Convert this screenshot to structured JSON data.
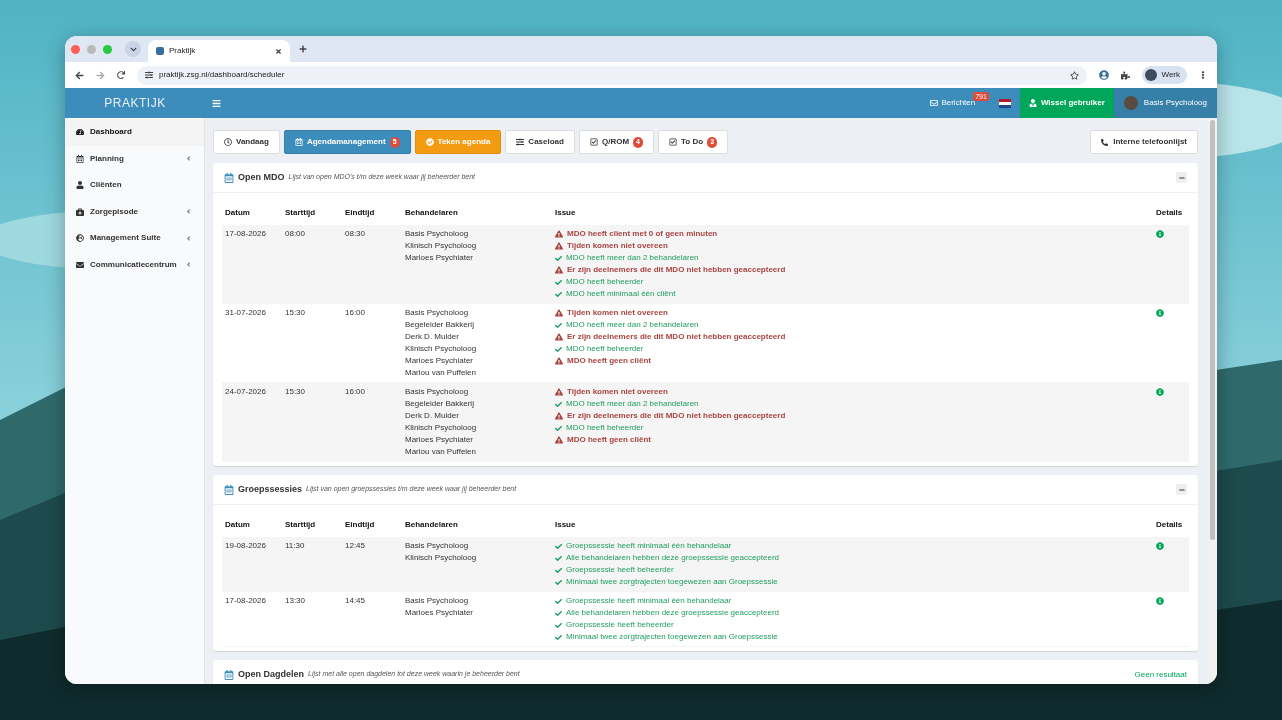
{
  "browser": {
    "tab_title": "Praktijk",
    "url": "praktijk.zsg.nl/dashboard/scheduler",
    "profile": "Werk"
  },
  "navbar": {
    "brand": "PRAKTIJK",
    "messages": {
      "label": "Berichten",
      "count": "791"
    },
    "switch_user": "Wissel gebruiker",
    "user": "Basis Psycholoog"
  },
  "sidebar": {
    "items": [
      {
        "label": "Dashboard",
        "selected": true,
        "submenu": false
      },
      {
        "label": "Planning",
        "selected": false,
        "submenu": true
      },
      {
        "label": "Cliënten",
        "selected": false,
        "submenu": false
      },
      {
        "label": "Zorgepisode",
        "selected": false,
        "submenu": true
      },
      {
        "label": "Management Suite",
        "selected": false,
        "submenu": true
      },
      {
        "label": "Communicatiecentrum",
        "selected": false,
        "submenu": true
      }
    ]
  },
  "toolbar": {
    "buttons": [
      {
        "label": "Vandaag",
        "kind": "default"
      },
      {
        "label": "Agendamanagement",
        "kind": "primary",
        "badge": "5"
      },
      {
        "label": "Teken agenda",
        "kind": "warning"
      },
      {
        "label": "Caseload",
        "kind": "default"
      },
      {
        "label": "Q/ROM",
        "kind": "default",
        "badge": "4"
      },
      {
        "label": "To Do",
        "kind": "default",
        "badge": "3"
      }
    ],
    "phone_list": "Interne telefoonlijst"
  },
  "panels": [
    {
      "title": "Open MDO",
      "subtitle": "Lijst van open MDO's t/m deze week waar jij beheerder bent",
      "columns": [
        "Datum",
        "Starttijd",
        "Eindtijd",
        "Behandelaren",
        "Issue",
        "Details"
      ],
      "rows": [
        {
          "datum": "17-08-2026",
          "start": "08:00",
          "end": "08:30",
          "behandelaren": [
            "Basis Psycholoog",
            "Klinisch Psycholoog",
            "Marloes Psychiater"
          ],
          "issues": [
            {
              "kind": "error",
              "text": "MDO heeft client met 0 of geen minuten"
            },
            {
              "kind": "error",
              "text": "Tijden komen niet overeen"
            },
            {
              "kind": "ok",
              "text": "MDO heeft meer dan 2 behandelaren"
            },
            {
              "kind": "error",
              "text": "Er zijn deelnemers die dit MDO niet hebben geaccepteerd"
            },
            {
              "kind": "ok",
              "text": "MDO heeft beheerder"
            },
            {
              "kind": "ok",
              "text": "MDO heeft minimaal één cliënt"
            }
          ]
        },
        {
          "datum": "31-07-2026",
          "start": "15:30",
          "end": "16:00",
          "behandelaren": [
            "Basis Psycholoog",
            "Begeleider Bakkerij",
            "Derk D. Mulder",
            "Klinisch Psycholoog",
            "Marloes Psychiater",
            "Marlou van Puffelen"
          ],
          "issues": [
            {
              "kind": "error",
              "text": "Tijden komen niet overeen"
            },
            {
              "kind": "ok",
              "text": "MDO heeft meer dan 2 behandelaren"
            },
            {
              "kind": "error",
              "text": "Er zijn deelnemers die dit MDO niet hebben geaccepteerd"
            },
            {
              "kind": "ok",
              "text": "MDO heeft beheerder"
            },
            {
              "kind": "error",
              "text": "MDO heeft geen cliënt"
            }
          ]
        },
        {
          "datum": "24-07-2026",
          "start": "15:30",
          "end": "16:00",
          "behandelaren": [
            "Basis Psycholoog",
            "Begeleider Bakkerij",
            "Derk D. Mulder",
            "Klinisch Psycholoog",
            "Marloes Psychiater",
            "Marlou van Puffelen"
          ],
          "issues": [
            {
              "kind": "error",
              "text": "Tijden komen niet overeen"
            },
            {
              "kind": "ok",
              "text": "MDO heeft meer dan 2 behandelaren"
            },
            {
              "kind": "error",
              "text": "Er zijn deelnemers die dit MDO niet hebben geaccepteerd"
            },
            {
              "kind": "ok",
              "text": "MDO heeft beheerder"
            },
            {
              "kind": "error",
              "text": "MDO heeft geen cliënt"
            }
          ]
        }
      ]
    },
    {
      "title": "Groepssessies",
      "subtitle": "Lijst van open groepssessies t/m deze week waar jij beheerder bent",
      "columns": [
        "Datum",
        "Starttijd",
        "Eindtijd",
        "Behandelaren",
        "Issue",
        "Details"
      ],
      "rows": [
        {
          "datum": "19-08-2026",
          "start": "11:30",
          "end": "12:45",
          "behandelaren": [
            "Basis Psycholoog",
            "Klinisch Psycholoog"
          ],
          "issues": [
            {
              "kind": "ok",
              "text": "Groepssessie heeft minimaal één behandelaar"
            },
            {
              "kind": "ok",
              "text": "Alle behandelaren hebben deze groepssessie geaccepteerd"
            },
            {
              "kind": "ok",
              "text": "Groepssessie heeft beheerder"
            },
            {
              "kind": "ok",
              "text": "Minimaal twee zorgtrajecten toegewezen aan Groepssessie"
            }
          ]
        },
        {
          "datum": "17-08-2026",
          "start": "13:30",
          "end": "14:45",
          "behandelaren": [
            "Basis Psycholoog",
            "Marloes Psychiater"
          ],
          "issues": [
            {
              "kind": "ok",
              "text": "Groepssessie heeft minimaal één behandelaar"
            },
            {
              "kind": "ok",
              "text": "Alle behandelaren hebben deze groepssessie geaccepteerd"
            },
            {
              "kind": "ok",
              "text": "Groepssessie heeft beheerder"
            },
            {
              "kind": "ok",
              "text": "Minimaal twee zorgtrajecten toegewezen aan Groepssessie"
            }
          ]
        }
      ]
    },
    {
      "title": "Open Dagdelen",
      "subtitle": "Lijst met alle open dagdelen tot deze week waarin je beheerder bent",
      "empty_text": "Geen resultaat"
    }
  ]
}
